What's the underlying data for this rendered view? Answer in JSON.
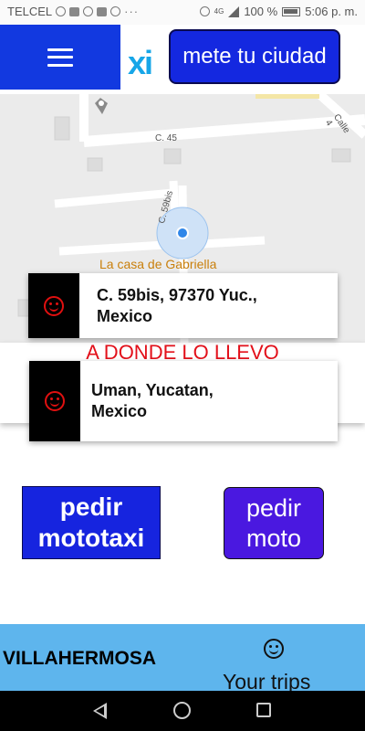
{
  "status_bar": {
    "carrier": "TELCEL",
    "network": "4G",
    "battery": "100 %",
    "time": "5:06 p. m."
  },
  "header": {
    "menu_icon": "hamburger-icon",
    "logo": "xi",
    "city_button": "mete tu ciudad"
  },
  "map": {
    "street_label_1": "C. 45",
    "street_label_2": "C. 59bis",
    "street_label_3": "Calle 4",
    "place_label": "La casa de Gabriella"
  },
  "origin": {
    "icon": "smiley-icon",
    "address": "C. 59bis, 97370 Yuc., Mexico"
  },
  "destination_prompt": "A DONDE LO LLEVO",
  "destination": {
    "icon": "smiley-icon",
    "address": "Uman, Yucatan, Mexico"
  },
  "actions": {
    "mototaxi": "pedir mototaxi",
    "moto": "pedir moto"
  },
  "bottom_bar": {
    "city": "VILLAHERMOSA",
    "trips_icon": "smiley-icon",
    "trips_label": "Your trips"
  },
  "colors": {
    "primary_blue": "#1239e0",
    "button_blue": "#1624df",
    "button_purple": "#4a18e0",
    "prompt_red": "#e3101a",
    "bottom_bar": "#5eb5ed"
  }
}
